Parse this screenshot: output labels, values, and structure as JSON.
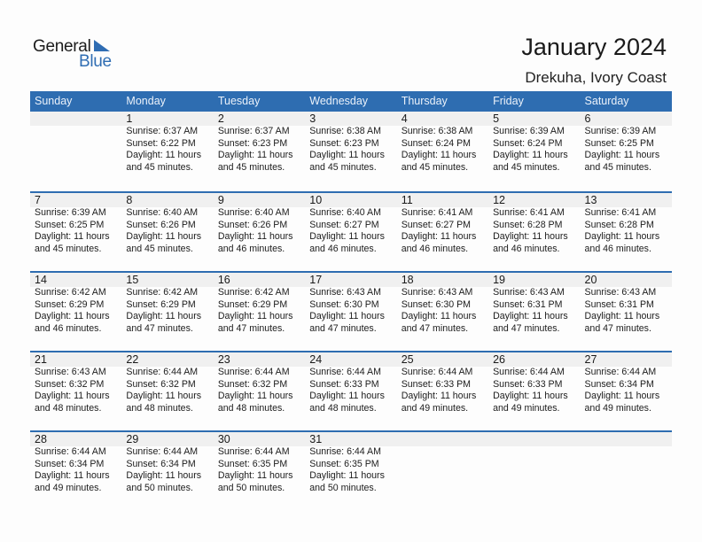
{
  "logo": {
    "general": "General",
    "blue": "Blue",
    "icon": "triangle-flag-icon",
    "accent": "#2f6db3"
  },
  "header": {
    "title": "January 2024",
    "subtitle": "Drekuha, Ivory Coast"
  },
  "colors": {
    "header_bg": "#2e6db1",
    "daynum_band": "#f0f0f0"
  },
  "weekdays": [
    "Sunday",
    "Monday",
    "Tuesday",
    "Wednesday",
    "Thursday",
    "Friday",
    "Saturday"
  ],
  "weeks": [
    [
      null,
      {
        "day": "1",
        "sunrise": "Sunrise: 6:37 AM",
        "sunset": "Sunset: 6:22 PM",
        "daylight1": "Daylight: 11 hours",
        "daylight2": "and 45 minutes."
      },
      {
        "day": "2",
        "sunrise": "Sunrise: 6:37 AM",
        "sunset": "Sunset: 6:23 PM",
        "daylight1": "Daylight: 11 hours",
        "daylight2": "and 45 minutes."
      },
      {
        "day": "3",
        "sunrise": "Sunrise: 6:38 AM",
        "sunset": "Sunset: 6:23 PM",
        "daylight1": "Daylight: 11 hours",
        "daylight2": "and 45 minutes."
      },
      {
        "day": "4",
        "sunrise": "Sunrise: 6:38 AM",
        "sunset": "Sunset: 6:24 PM",
        "daylight1": "Daylight: 11 hours",
        "daylight2": "and 45 minutes."
      },
      {
        "day": "5",
        "sunrise": "Sunrise: 6:39 AM",
        "sunset": "Sunset: 6:24 PM",
        "daylight1": "Daylight: 11 hours",
        "daylight2": "and 45 minutes."
      },
      {
        "day": "6",
        "sunrise": "Sunrise: 6:39 AM",
        "sunset": "Sunset: 6:25 PM",
        "daylight1": "Daylight: 11 hours",
        "daylight2": "and 45 minutes."
      }
    ],
    [
      {
        "day": "7",
        "sunrise": "Sunrise: 6:39 AM",
        "sunset": "Sunset: 6:25 PM",
        "daylight1": "Daylight: 11 hours",
        "daylight2": "and 45 minutes."
      },
      {
        "day": "8",
        "sunrise": "Sunrise: 6:40 AM",
        "sunset": "Sunset: 6:26 PM",
        "daylight1": "Daylight: 11 hours",
        "daylight2": "and 45 minutes."
      },
      {
        "day": "9",
        "sunrise": "Sunrise: 6:40 AM",
        "sunset": "Sunset: 6:26 PM",
        "daylight1": "Daylight: 11 hours",
        "daylight2": "and 46 minutes."
      },
      {
        "day": "10",
        "sunrise": "Sunrise: 6:40 AM",
        "sunset": "Sunset: 6:27 PM",
        "daylight1": "Daylight: 11 hours",
        "daylight2": "and 46 minutes."
      },
      {
        "day": "11",
        "sunrise": "Sunrise: 6:41 AM",
        "sunset": "Sunset: 6:27 PM",
        "daylight1": "Daylight: 11 hours",
        "daylight2": "and 46 minutes."
      },
      {
        "day": "12",
        "sunrise": "Sunrise: 6:41 AM",
        "sunset": "Sunset: 6:28 PM",
        "daylight1": "Daylight: 11 hours",
        "daylight2": "and 46 minutes."
      },
      {
        "day": "13",
        "sunrise": "Sunrise: 6:41 AM",
        "sunset": "Sunset: 6:28 PM",
        "daylight1": "Daylight: 11 hours",
        "daylight2": "and 46 minutes."
      }
    ],
    [
      {
        "day": "14",
        "sunrise": "Sunrise: 6:42 AM",
        "sunset": "Sunset: 6:29 PM",
        "daylight1": "Daylight: 11 hours",
        "daylight2": "and 46 minutes."
      },
      {
        "day": "15",
        "sunrise": "Sunrise: 6:42 AM",
        "sunset": "Sunset: 6:29 PM",
        "daylight1": "Daylight: 11 hours",
        "daylight2": "and 47 minutes."
      },
      {
        "day": "16",
        "sunrise": "Sunrise: 6:42 AM",
        "sunset": "Sunset: 6:29 PM",
        "daylight1": "Daylight: 11 hours",
        "daylight2": "and 47 minutes."
      },
      {
        "day": "17",
        "sunrise": "Sunrise: 6:43 AM",
        "sunset": "Sunset: 6:30 PM",
        "daylight1": "Daylight: 11 hours",
        "daylight2": "and 47 minutes."
      },
      {
        "day": "18",
        "sunrise": "Sunrise: 6:43 AM",
        "sunset": "Sunset: 6:30 PM",
        "daylight1": "Daylight: 11 hours",
        "daylight2": "and 47 minutes."
      },
      {
        "day": "19",
        "sunrise": "Sunrise: 6:43 AM",
        "sunset": "Sunset: 6:31 PM",
        "daylight1": "Daylight: 11 hours",
        "daylight2": "and 47 minutes."
      },
      {
        "day": "20",
        "sunrise": "Sunrise: 6:43 AM",
        "sunset": "Sunset: 6:31 PM",
        "daylight1": "Daylight: 11 hours",
        "daylight2": "and 47 minutes."
      }
    ],
    [
      {
        "day": "21",
        "sunrise": "Sunrise: 6:43 AM",
        "sunset": "Sunset: 6:32 PM",
        "daylight1": "Daylight: 11 hours",
        "daylight2": "and 48 minutes."
      },
      {
        "day": "22",
        "sunrise": "Sunrise: 6:44 AM",
        "sunset": "Sunset: 6:32 PM",
        "daylight1": "Daylight: 11 hours",
        "daylight2": "and 48 minutes."
      },
      {
        "day": "23",
        "sunrise": "Sunrise: 6:44 AM",
        "sunset": "Sunset: 6:32 PM",
        "daylight1": "Daylight: 11 hours",
        "daylight2": "and 48 minutes."
      },
      {
        "day": "24",
        "sunrise": "Sunrise: 6:44 AM",
        "sunset": "Sunset: 6:33 PM",
        "daylight1": "Daylight: 11 hours",
        "daylight2": "and 48 minutes."
      },
      {
        "day": "25",
        "sunrise": "Sunrise: 6:44 AM",
        "sunset": "Sunset: 6:33 PM",
        "daylight1": "Daylight: 11 hours",
        "daylight2": "and 49 minutes."
      },
      {
        "day": "26",
        "sunrise": "Sunrise: 6:44 AM",
        "sunset": "Sunset: 6:33 PM",
        "daylight1": "Daylight: 11 hours",
        "daylight2": "and 49 minutes."
      },
      {
        "day": "27",
        "sunrise": "Sunrise: 6:44 AM",
        "sunset": "Sunset: 6:34 PM",
        "daylight1": "Daylight: 11 hours",
        "daylight2": "and 49 minutes."
      }
    ],
    [
      {
        "day": "28",
        "sunrise": "Sunrise: 6:44 AM",
        "sunset": "Sunset: 6:34 PM",
        "daylight1": "Daylight: 11 hours",
        "daylight2": "and 49 minutes."
      },
      {
        "day": "29",
        "sunrise": "Sunrise: 6:44 AM",
        "sunset": "Sunset: 6:34 PM",
        "daylight1": "Daylight: 11 hours",
        "daylight2": "and 50 minutes."
      },
      {
        "day": "30",
        "sunrise": "Sunrise: 6:44 AM",
        "sunset": "Sunset: 6:35 PM",
        "daylight1": "Daylight: 11 hours",
        "daylight2": "and 50 minutes."
      },
      {
        "day": "31",
        "sunrise": "Sunrise: 6:44 AM",
        "sunset": "Sunset: 6:35 PM",
        "daylight1": "Daylight: 11 hours",
        "daylight2": "and 50 minutes."
      },
      null,
      null,
      null
    ]
  ]
}
